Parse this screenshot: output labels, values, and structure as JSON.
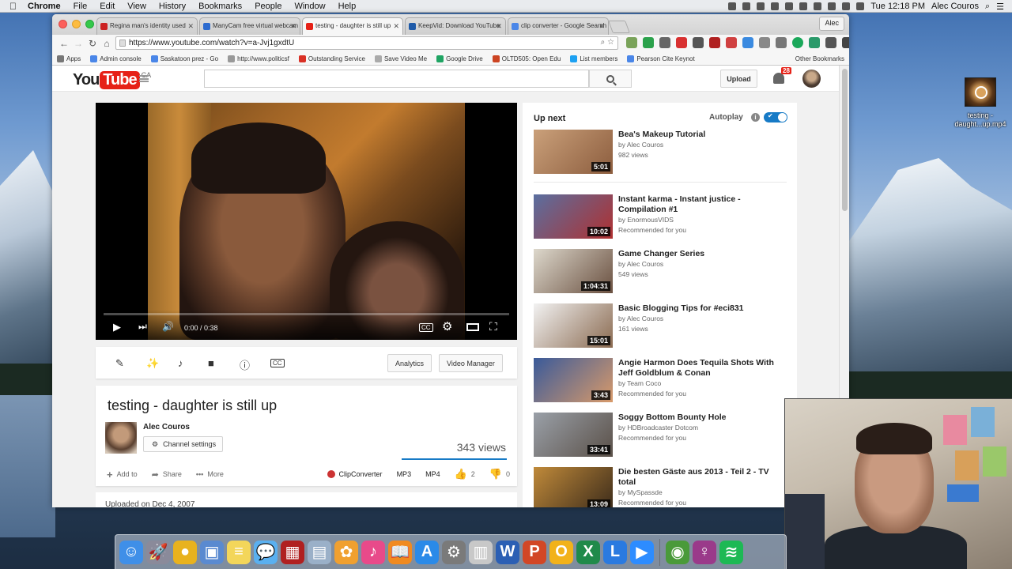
{
  "menubar": {
    "app": "Chrome",
    "items": [
      "File",
      "Edit",
      "View",
      "History",
      "Bookmarks",
      "People",
      "Window",
      "Help"
    ],
    "clock": "Tue 12:18 PM",
    "user": "Alec Couros"
  },
  "browser": {
    "profile": "Alec",
    "tabs": [
      {
        "title": "Regina man's identity used",
        "color": "#cc2222"
      },
      {
        "title": "ManyCam free virtual webcam",
        "color": "#2d6bcf"
      },
      {
        "title": "testing - daughter is still up",
        "color": "#e62117",
        "active": true
      },
      {
        "title": "KeepVid: Download YouTube",
        "color": "#1e5aa8"
      },
      {
        "title": "clip converter - Google Search",
        "color": "#4a86e8"
      }
    ],
    "url": "https://www.youtube.com/watch?v=a-Jvj1gxdtU",
    "bookmarks": [
      {
        "label": "Apps",
        "color": "#777"
      },
      {
        "label": "Admin console",
        "color": "#4a86e8"
      },
      {
        "label": "Saskatoon prez - Go",
        "color": "#4a86e8"
      },
      {
        "label": "http://www.politicsf",
        "color": "#999"
      },
      {
        "label": "Outstanding Service",
        "color": "#d93025"
      },
      {
        "label": "Save Video Me",
        "color": "#aaa"
      },
      {
        "label": "Google Drive",
        "color": "#1fa463"
      },
      {
        "label": "OLTD505: Open Edu",
        "color": "#cc4422"
      },
      {
        "label": "List members",
        "color": "#1da1f2"
      },
      {
        "label": "Pearson Cite Keynot",
        "color": "#4a86e8"
      }
    ],
    "other_bookmarks": "Other Bookmarks"
  },
  "youtube": {
    "logo_you": "You",
    "logo_tube": "Tube",
    "region": "CA",
    "upload_label": "Upload",
    "notification_count": "28",
    "player": {
      "time": "0:00 / 0:38",
      "progress_fraction": 0.0
    },
    "actions": {
      "analytics_label": "Analytics",
      "video_manager_label": "Video Manager"
    },
    "video": {
      "title": "testing - daughter is still up",
      "channel": "Alec Couros",
      "channel_settings_label": "Channel settings",
      "views": "343 views",
      "add_to_label": "Add to",
      "share_label": "Share",
      "more_label": "More",
      "clipconverter_label": "ClipConverter",
      "mp3_label": "MP3",
      "mp4_label": "MP4",
      "likes": "2",
      "dislikes": "0",
      "uploaded": "Uploaded on Dec 4, 2007"
    },
    "sidebar": {
      "up_next_label": "Up next",
      "autoplay_label": "Autoplay",
      "items": [
        {
          "title": "Bea's Makeup Tutorial",
          "by": "by Alec Couros",
          "meta": "982 views",
          "duration": "5:01",
          "thumb": [
            "#caa07a",
            "#8c5d3e"
          ]
        },
        {
          "title": "Instant karma - Instant justice - Compilation #1",
          "by": "by EnormousVIDS",
          "meta": "Recommended for you",
          "duration": "10:02",
          "thumb": [
            "#5a6fa0",
            "#b03030"
          ]
        },
        {
          "title": "Game Changer Series",
          "by": "by Alec Couros",
          "meta": "549 views",
          "duration": "1:04:31",
          "thumb": [
            "#ddd8cc",
            "#6a5040"
          ]
        },
        {
          "title": "Basic Blogging Tips for #eci831",
          "by": "by Alec Couros",
          "meta": "161 views",
          "duration": "15:01",
          "thumb": [
            "#f2f2f2",
            "#8a6a50"
          ]
        },
        {
          "title": "Angie Harmon Does Tequila Shots With Jeff Goldblum & Conan",
          "by": "by Team Coco",
          "meta": "Recommended for you",
          "duration": "3:43",
          "thumb": [
            "#3a5a9a",
            "#d89a6a"
          ]
        },
        {
          "title": "Soggy Bottom Bounty Hole",
          "by": "by HDBroadcaster Dotcom",
          "meta": "Recommended for you",
          "duration": "33:41",
          "thumb": [
            "#9aa0a8",
            "#5a5048"
          ]
        },
        {
          "title": "Die besten Gäste aus 2013 - Teil 2 - TV total",
          "by": "by MySpassde",
          "meta": "Recommended for you",
          "duration": "13:09",
          "thumb": [
            "#c08a3a",
            "#3a2a1a"
          ]
        }
      ]
    }
  },
  "desktop": {
    "file_label": "testing - daught...up.mp4"
  },
  "dock": [
    {
      "name": "finder",
      "color": "#3f8fe8",
      "glyph": "☺"
    },
    {
      "name": "launchpad",
      "color": "#8a8a9a",
      "glyph": "🚀"
    },
    {
      "name": "chrome",
      "color": "#e8b21e",
      "glyph": "●"
    },
    {
      "name": "preview",
      "color": "#5a8ad0",
      "glyph": "▣"
    },
    {
      "name": "notes",
      "color": "#f3d65a",
      "glyph": "≡"
    },
    {
      "name": "messages",
      "color": "#5ab0f0",
      "glyph": "💬"
    },
    {
      "name": "photo-booth",
      "color": "#b02020",
      "glyph": "▦"
    },
    {
      "name": "image-capture",
      "color": "#9ab0c8",
      "glyph": "▤"
    },
    {
      "name": "photos",
      "color": "#f0a030",
      "glyph": "✿"
    },
    {
      "name": "itunes",
      "color": "#e84a8a",
      "glyph": "♪"
    },
    {
      "name": "ibooks",
      "color": "#f08a20",
      "glyph": "📖"
    },
    {
      "name": "app-store",
      "color": "#2a8ae8",
      "glyph": "A"
    },
    {
      "name": "system-preferences",
      "color": "#7a7a7a",
      "glyph": "⚙"
    },
    {
      "name": "file-manager",
      "color": "#c8c8c8",
      "glyph": "▥"
    },
    {
      "name": "word",
      "color": "#2b5fb4",
      "glyph": "W"
    },
    {
      "name": "powerpoint",
      "color": "#d24726",
      "glyph": "P"
    },
    {
      "name": "outlook",
      "color": "#f2b21a",
      "glyph": "O"
    },
    {
      "name": "excel",
      "color": "#1f8a4a",
      "glyph": "X"
    },
    {
      "name": "lync",
      "color": "#2a7ae0",
      "glyph": "L"
    },
    {
      "name": "zoom",
      "color": "#2d8cff",
      "glyph": "▶"
    },
    {
      "name": "globe-app",
      "color": "#4a9a3a",
      "glyph": "◉"
    },
    {
      "name": "feminism-app",
      "color": "#9a3a8a",
      "glyph": "♀"
    },
    {
      "name": "spotify",
      "color": "#1db954",
      "glyph": "≋"
    }
  ]
}
